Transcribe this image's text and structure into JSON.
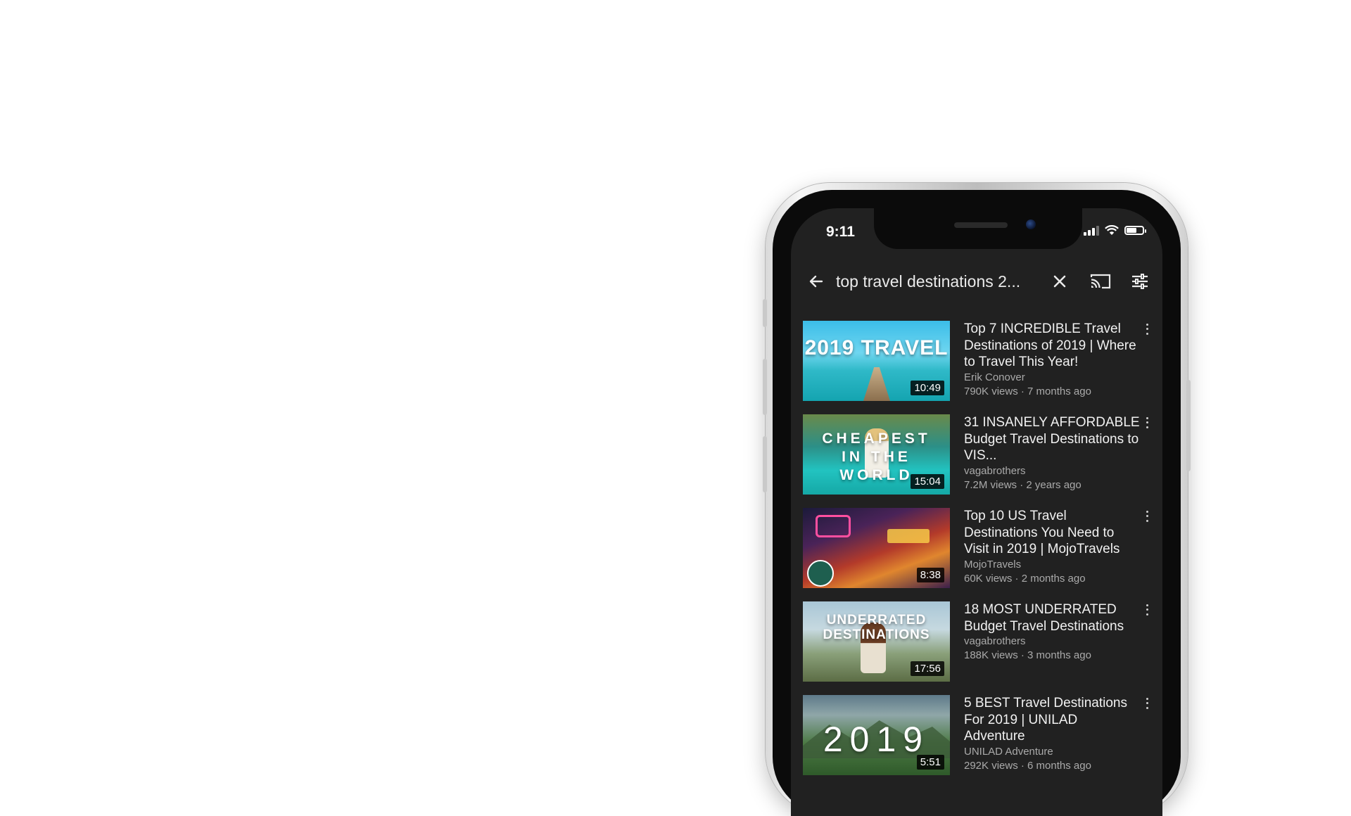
{
  "status_bar": {
    "time": "9:11"
  },
  "search": {
    "query": "top travel destinations 2...",
    "back_icon": "arrow-left-icon",
    "clear_icon": "close-icon",
    "cast_icon": "cast-icon",
    "filter_icon": "filter-sliders-icon"
  },
  "results": [
    {
      "thumb_text": "2019 TRAVEL",
      "duration": "10:49",
      "title": "Top 7 INCREDIBLE Travel Destinations of 2019 | Where to Travel This Year!",
      "channel": "Erik Conover",
      "meta": "790K views · 7 months ago"
    },
    {
      "thumb_text": "CHEAPEST IN THE WORLD",
      "duration": "15:04",
      "title": "31 INSANELY AFFORDABLE Budget Travel Destinations to VIS...",
      "channel": "vagabrothers",
      "meta": "7.2M views · 2 years ago"
    },
    {
      "thumb_text": "",
      "duration": "8:38",
      "title": "Top 10 US Travel Destinations You Need to Visit in 2019 | MojoTravels",
      "channel": "MojoTravels",
      "meta": "60K views · 2 months ago"
    },
    {
      "thumb_text": "UNDERRATED DESTINATIONS",
      "duration": "17:56",
      "title": "18 MOST UNDERRATED Budget Travel Destinations",
      "channel": "vagabrothers",
      "meta": "188K views · 3 months ago"
    },
    {
      "thumb_text": "2019",
      "duration": "5:51",
      "title": "5 BEST Travel Destinations For 2019 | UNILAD Adventure",
      "channel": "UNILAD Adventure",
      "meta": "292K views · 6 months ago"
    }
  ]
}
